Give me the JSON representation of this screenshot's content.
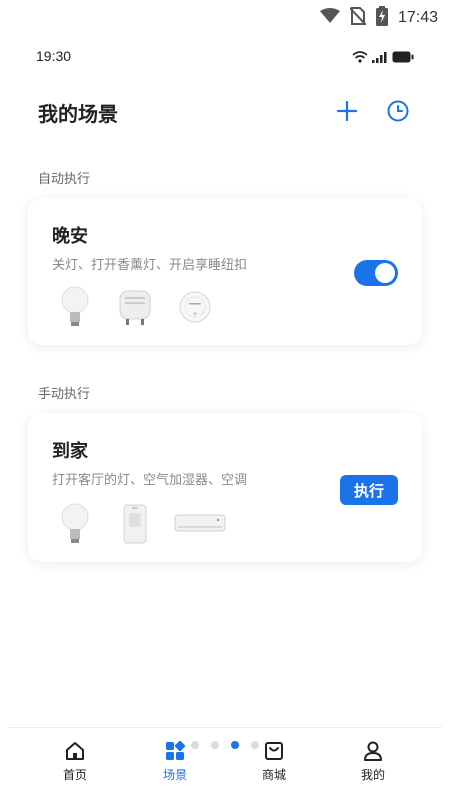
{
  "system_status": {
    "time": "17:43"
  },
  "status_bar": {
    "time": "19:30"
  },
  "header": {
    "title": "我的场景"
  },
  "sections": {
    "auto_label": "自动执行",
    "manual_label": "手动执行"
  },
  "auto_scene": {
    "title": "晚安",
    "description": "关灯、打开香薰灯、开启享睡纽扣",
    "enabled": true,
    "devices": [
      "light-bulb-icon",
      "aroma-diffuser-icon",
      "sleep-button-device-icon"
    ]
  },
  "manual_scene": {
    "title": "到家",
    "description": "打开客厅的灯、空气加湿器、空调",
    "button_label": "执行",
    "devices": [
      "light-bulb-icon",
      "humidifier-icon",
      "air-conditioner-icon"
    ]
  },
  "bottom_nav": [
    {
      "label": "首页",
      "icon": "home-icon",
      "active": false
    },
    {
      "label": "场景",
      "icon": "scenes-icon",
      "active": true
    },
    {
      "label": "商城",
      "icon": "store-icon",
      "active": false
    },
    {
      "label": "我的",
      "icon": "profile-icon",
      "active": false
    }
  ],
  "pager": {
    "count": 4,
    "active_index": 2
  },
  "colors": {
    "accent": "#1a73e8",
    "text_primary": "#222222",
    "text_secondary": "#8a8a8a",
    "background": "#ffffff"
  }
}
